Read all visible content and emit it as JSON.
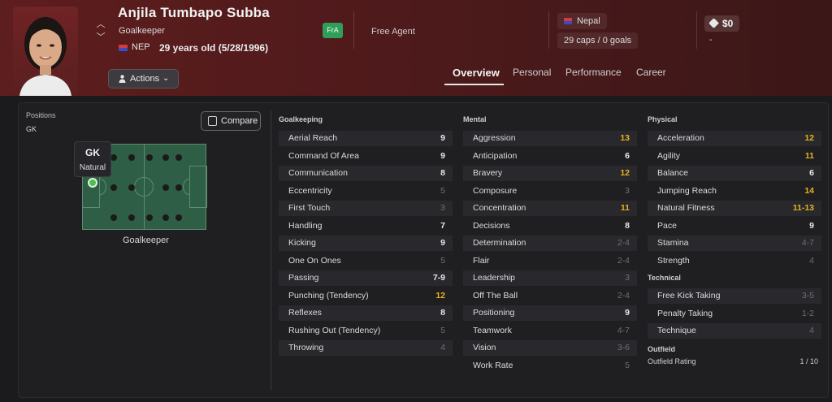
{
  "header": {
    "player_name": "Anjila Tumbapo Subba",
    "role": "Goalkeeper",
    "nationality_code": "NEP",
    "age_text": "29 years old (5/28/1996)",
    "status_badge": "FrA",
    "contract_status": "Free Agent",
    "national_team": "Nepal",
    "caps_goals": "29 caps / 0 goals",
    "value": "$0",
    "value_sub": "-",
    "actions_label": "Actions",
    "flag_colors": [
      "#d43b3b",
      "#3a4bc5"
    ],
    "background_color": "#5e1d1e"
  },
  "tabs": [
    {
      "label": "Overview",
      "active": true
    },
    {
      "label": "Personal",
      "active": false
    },
    {
      "label": "Performance",
      "active": false
    },
    {
      "label": "Career",
      "active": false
    }
  ],
  "positions": {
    "label": "Positions",
    "value": "GK",
    "compare_label": "Compare",
    "tooltip_position": "GK",
    "tooltip_rating": "Natural",
    "pitch_caption": "Goalkeeper",
    "pitch_color": "#2e5e45",
    "selected_color": "#4fc04a"
  },
  "goalkeeping": {
    "title": "Goalkeeping",
    "attributes": [
      {
        "name": "Aerial Reach",
        "value": "9",
        "level": "mid"
      },
      {
        "name": "Command Of Area",
        "value": "9",
        "level": "mid"
      },
      {
        "name": "Communication",
        "value": "8",
        "level": "mid"
      },
      {
        "name": "Eccentricity",
        "value": "5",
        "level": "dim"
      },
      {
        "name": "First Touch",
        "value": "3",
        "level": "dim"
      },
      {
        "name": "Handling",
        "value": "7",
        "level": "mid"
      },
      {
        "name": "Kicking",
        "value": "9",
        "level": "mid"
      },
      {
        "name": "One On Ones",
        "value": "5",
        "level": "dim"
      },
      {
        "name": "Passing",
        "value": "7-9",
        "level": "mid"
      },
      {
        "name": "Punching (Tendency)",
        "value": "12",
        "level": "hi"
      },
      {
        "name": "Reflexes",
        "value": "8",
        "level": "mid"
      },
      {
        "name": "Rushing Out (Tendency)",
        "value": "5",
        "level": "dim"
      },
      {
        "name": "Throwing",
        "value": "4",
        "level": "dim"
      }
    ]
  },
  "mental": {
    "title": "Mental",
    "attributes": [
      {
        "name": "Aggression",
        "value": "13",
        "level": "hi"
      },
      {
        "name": "Anticipation",
        "value": "6",
        "level": "mid"
      },
      {
        "name": "Bravery",
        "value": "12",
        "level": "hi"
      },
      {
        "name": "Composure",
        "value": "3",
        "level": "dim"
      },
      {
        "name": "Concentration",
        "value": "11",
        "level": "hi"
      },
      {
        "name": "Decisions",
        "value": "8",
        "level": "mid"
      },
      {
        "name": "Determination",
        "value": "2-4",
        "level": "dim"
      },
      {
        "name": "Flair",
        "value": "2-4",
        "level": "dim"
      },
      {
        "name": "Leadership",
        "value": "3",
        "level": "dim"
      },
      {
        "name": "Off The Ball",
        "value": "2-4",
        "level": "dim"
      },
      {
        "name": "Positioning",
        "value": "9",
        "level": "mid"
      },
      {
        "name": "Teamwork",
        "value": "4-7",
        "level": "dim"
      },
      {
        "name": "Vision",
        "value": "3-6",
        "level": "dim"
      },
      {
        "name": "Work Rate",
        "value": "5",
        "level": "dim"
      }
    ]
  },
  "physical": {
    "title": "Physical",
    "attributes": [
      {
        "name": "Acceleration",
        "value": "12",
        "level": "hi"
      },
      {
        "name": "Agility",
        "value": "11",
        "level": "hi"
      },
      {
        "name": "Balance",
        "value": "6",
        "level": "mid"
      },
      {
        "name": "Jumping Reach",
        "value": "14",
        "level": "hi"
      },
      {
        "name": "Natural Fitness",
        "value": "11-13",
        "level": "hi"
      },
      {
        "name": "Pace",
        "value": "9",
        "level": "mid"
      },
      {
        "name": "Stamina",
        "value": "4-7",
        "level": "dim"
      },
      {
        "name": "Strength",
        "value": "4",
        "level": "dim"
      }
    ]
  },
  "technical": {
    "title": "Technical",
    "attributes": [
      {
        "name": "Free Kick Taking",
        "value": "3-5",
        "level": "dim"
      },
      {
        "name": "Penalty Taking",
        "value": "1-2",
        "level": "dim"
      },
      {
        "name": "Technique",
        "value": "4",
        "level": "dim"
      }
    ]
  },
  "outfield": {
    "title": "Outfield",
    "label": "Outfield Rating",
    "value": "1 / 10"
  },
  "colors": {
    "highlight": "#e8b21c",
    "dim": "#6f6f73",
    "normal": "#e9e9e9"
  }
}
